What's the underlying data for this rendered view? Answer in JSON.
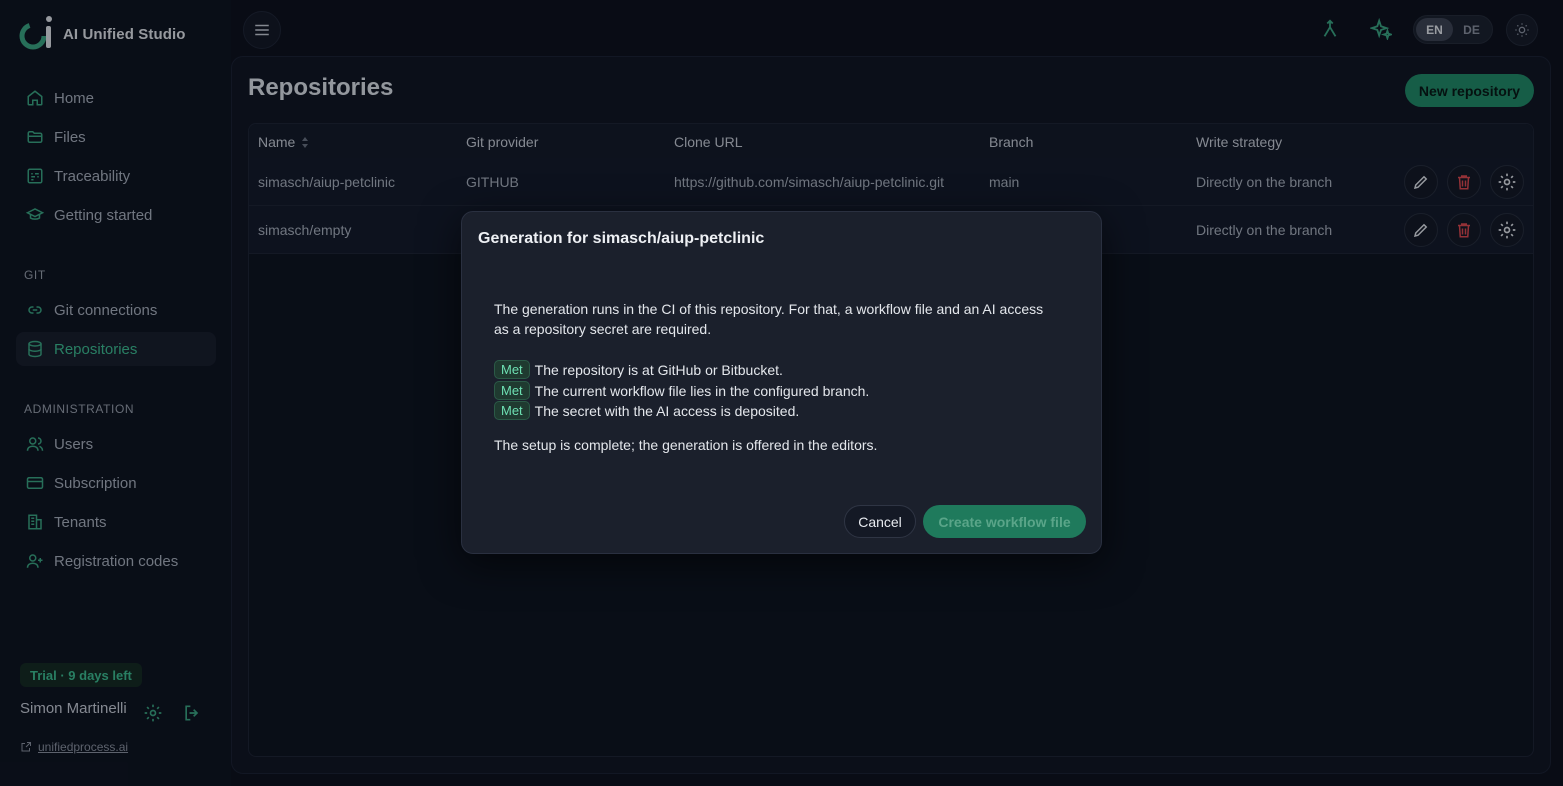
{
  "app": {
    "name": "AI Unified Studio"
  },
  "sidebar": {
    "items": [
      {
        "label": "Home",
        "icon": "home-icon"
      },
      {
        "label": "Files",
        "icon": "folder-icon"
      },
      {
        "label": "Traceability",
        "icon": "traceability-icon"
      },
      {
        "label": "Getting started",
        "icon": "graduation-cap-icon"
      }
    ],
    "git_section": "GIT",
    "git_items": [
      {
        "label": "Git connections",
        "icon": "link-icon"
      },
      {
        "label": "Repositories",
        "icon": "database-icon",
        "active": true
      }
    ],
    "admin_section": "ADMINISTRATION",
    "admin_items": [
      {
        "label": "Users",
        "icon": "users-icon"
      },
      {
        "label": "Subscription",
        "icon": "credit-card-icon"
      },
      {
        "label": "Tenants",
        "icon": "building-icon"
      },
      {
        "label": "Registration codes",
        "icon": "user-plus-icon"
      }
    ],
    "trial_badge": "Trial · 9 days left",
    "user_name": "Simon Martinelli",
    "footer_link": "unifiedprocess.ai"
  },
  "topbar": {
    "languages": [
      "EN",
      "DE"
    ],
    "selected_language": "EN"
  },
  "page": {
    "title": "Repositories",
    "new_button": "New repository"
  },
  "table": {
    "columns": [
      "Name",
      "Git provider",
      "Clone URL",
      "Branch",
      "Write strategy"
    ],
    "rows": [
      {
        "name": "simasch/aiup-petclinic",
        "provider": "GITHUB",
        "url": "https://github.com/simasch/aiup-petclinic.git",
        "branch": "main",
        "strategy": "Directly on the branch"
      },
      {
        "name": "simasch/empty",
        "provider": "",
        "url": "",
        "branch": "",
        "strategy": "Directly on the branch"
      }
    ]
  },
  "dialog": {
    "title": "Generation for simasch/aiup-petclinic",
    "intro": "The generation runs in the CI of this repository. For that, a workflow file and an AI access as a repository secret are required.",
    "badge": "Met",
    "requirements": [
      "The repository is at GitHub or Bitbucket.",
      "The current workflow file lies in the configured branch.",
      "The secret with the AI access is deposited."
    ],
    "complete": "The setup is complete; the generation is offered in the editors.",
    "cancel": "Cancel",
    "create": "Create workflow file"
  },
  "colors": {
    "accent": "#3cbf91",
    "background": "#0b0f1a",
    "danger": "#e0484d"
  }
}
